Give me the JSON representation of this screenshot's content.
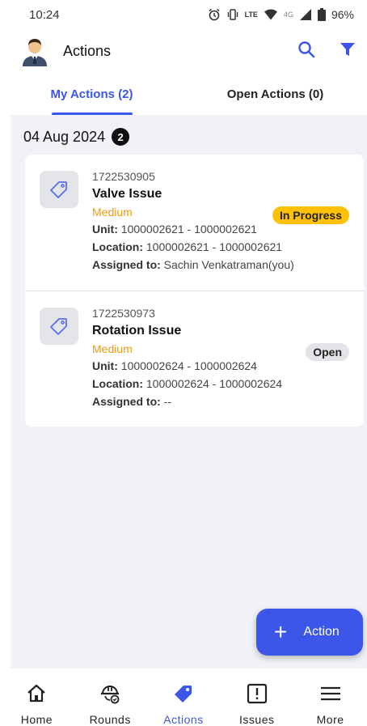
{
  "status_bar": {
    "time": "10:24",
    "lte_label": "LTE",
    "network_label": "4G",
    "battery": "96%"
  },
  "app_bar": {
    "title": "Actions"
  },
  "tabs": [
    {
      "label": "My Actions (2)",
      "active": true
    },
    {
      "label": "Open Actions (0)",
      "active": false
    }
  ],
  "group": {
    "date": "04 Aug 2024",
    "count": "2"
  },
  "actions": [
    {
      "id": "1722530905",
      "title": "Valve Issue",
      "priority": "Medium",
      "status": "In Progress",
      "unit_label": "Unit:",
      "unit_value": "1000002621 - 1000002621",
      "location_label": "Location:",
      "location_value": "1000002621 - 1000002621",
      "assigned_label": "Assigned to:",
      "assigned_value": "Sachin Venkatraman(you)"
    },
    {
      "id": "1722530973",
      "title": "Rotation Issue",
      "priority": "Medium",
      "status": "Open",
      "unit_label": "Unit:",
      "unit_value": "1000002624 - 1000002624",
      "location_label": "Location:",
      "location_value": "1000002624 - 1000002624",
      "assigned_label": "Assigned to:",
      "assigned_value": "--"
    }
  ],
  "fab": {
    "plus": "+",
    "label": "Action"
  },
  "bottom_nav": [
    {
      "label": "Home",
      "icon": "home-icon",
      "active": false
    },
    {
      "label": "Rounds",
      "icon": "hard-hat-icon",
      "active": false
    },
    {
      "label": "Actions",
      "icon": "tag-icon",
      "active": true
    },
    {
      "label": "Issues",
      "icon": "alert-box-icon",
      "active": false
    },
    {
      "label": "More",
      "icon": "menu-icon",
      "active": false
    }
  ],
  "colors": {
    "accent": "#3b56e8",
    "priority_medium": "#ef9a0c",
    "in_progress": "#ffc107",
    "open_chip": "#e3e4e8"
  }
}
